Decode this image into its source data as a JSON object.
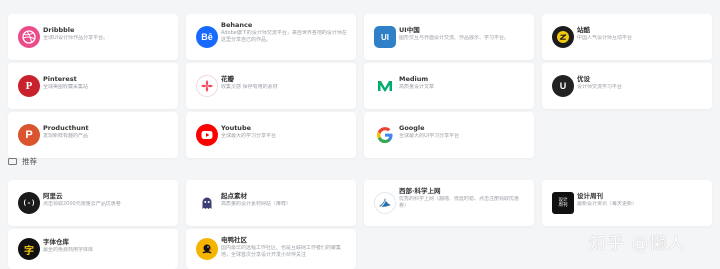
{
  "colors": {
    "background": "#f4f5f7",
    "card": "#ffffff",
    "title_text": "#333333",
    "desc_text": "#9a9fa6"
  },
  "cards_top": [
    {
      "id": "dribbble",
      "name": "Dribbble",
      "desc": "全球UI设计师作品分享平台。",
      "icon": "dribbble-icon",
      "color": "#ea4c89"
    },
    {
      "id": "behance",
      "name": "Behance",
      "desc": "Adobe旗下的设计师交流平台，来自世界各地的设计师在这里分享自己的作品。",
      "icon": "behance-icon",
      "color": "#1769ff"
    },
    {
      "id": "uichina",
      "name": "UI中国",
      "desc": "图形交互与界面设计交流、作品展示、学习平台。",
      "icon": "ui-china-icon",
      "color": "#2f80c7"
    },
    {
      "id": "zhanku",
      "name": "站酷",
      "desc": "中国人气设计师互动平台",
      "icon": "zcool-icon",
      "color": "#1c1c1c"
    },
    {
      "id": "pinterest",
      "name": "Pinterest",
      "desc": "全球美图收藏采集站",
      "icon": "pinterest-icon",
      "color": "#c8232c"
    },
    {
      "id": "huaban",
      "name": "花瓣",
      "desc": "收集灵感 保存有用的素材",
      "icon": "huaban-icon",
      "color": "#f34c5e"
    },
    {
      "id": "medium",
      "name": "Medium",
      "desc": "高质量设计文章",
      "icon": "medium-icon",
      "color": "#00ab6c"
    },
    {
      "id": "youshe",
      "name": "优设",
      "desc": "设计师交流学习平台",
      "icon": "uisdc-icon",
      "color": "#222222"
    },
    {
      "id": "producthunt",
      "name": "Producthunt",
      "desc": "发现新鲜有趣的产品",
      "icon": "producthunt-icon",
      "color": "#da552f"
    },
    {
      "id": "youtube",
      "name": "Youtube",
      "desc": "全球最大的学习分享平台",
      "icon": "youtube-icon",
      "color": "#ff0000"
    },
    {
      "id": "google",
      "name": "Google",
      "desc": "全球最大的UI学习分享平台",
      "icon": "google-icon",
      "color": "#4285f4"
    }
  ],
  "section": {
    "title": "推荐",
    "icon": "tag-icon"
  },
  "cards_recommended": [
    {
      "id": "aliyun",
      "name": "阿里云",
      "desc": "点击领取2000元限量云产品优惠卷",
      "icon": "aliyun-icon",
      "color": "#1a1a1a"
    },
    {
      "id": "jiyou",
      "name": "起点素材",
      "desc": "高质量的设计素材网站（推荐）",
      "icon": "ghost-icon",
      "color": "#3b3f72"
    },
    {
      "id": "xixi",
      "name": "西部·科学上网",
      "desc": "优秀的科学上网（翻墙、低延时稳、点击注册领取优惠券）",
      "icon": "xixi-icon",
      "color": "#2a6fa8"
    },
    {
      "id": "sheji",
      "name": "设计周刊",
      "desc": "最新设计资讯（每天更新）",
      "icon": "weekly-icon",
      "color": "#111111"
    },
    {
      "id": "ziti",
      "name": "字体仓库",
      "desc": "最全的免费商用字体库",
      "icon": "font-icon",
      "color": "#111111"
    },
    {
      "id": "dianshe",
      "name": "电鸭社区",
      "desc": "国内最早的远程工作社区、也是互联网工作者们的聚集地，全球首次分享设计开发小伙伴关注",
      "icon": "duck-icon",
      "color": "#f4b400"
    }
  ],
  "watermark": "知乎 @懒人"
}
